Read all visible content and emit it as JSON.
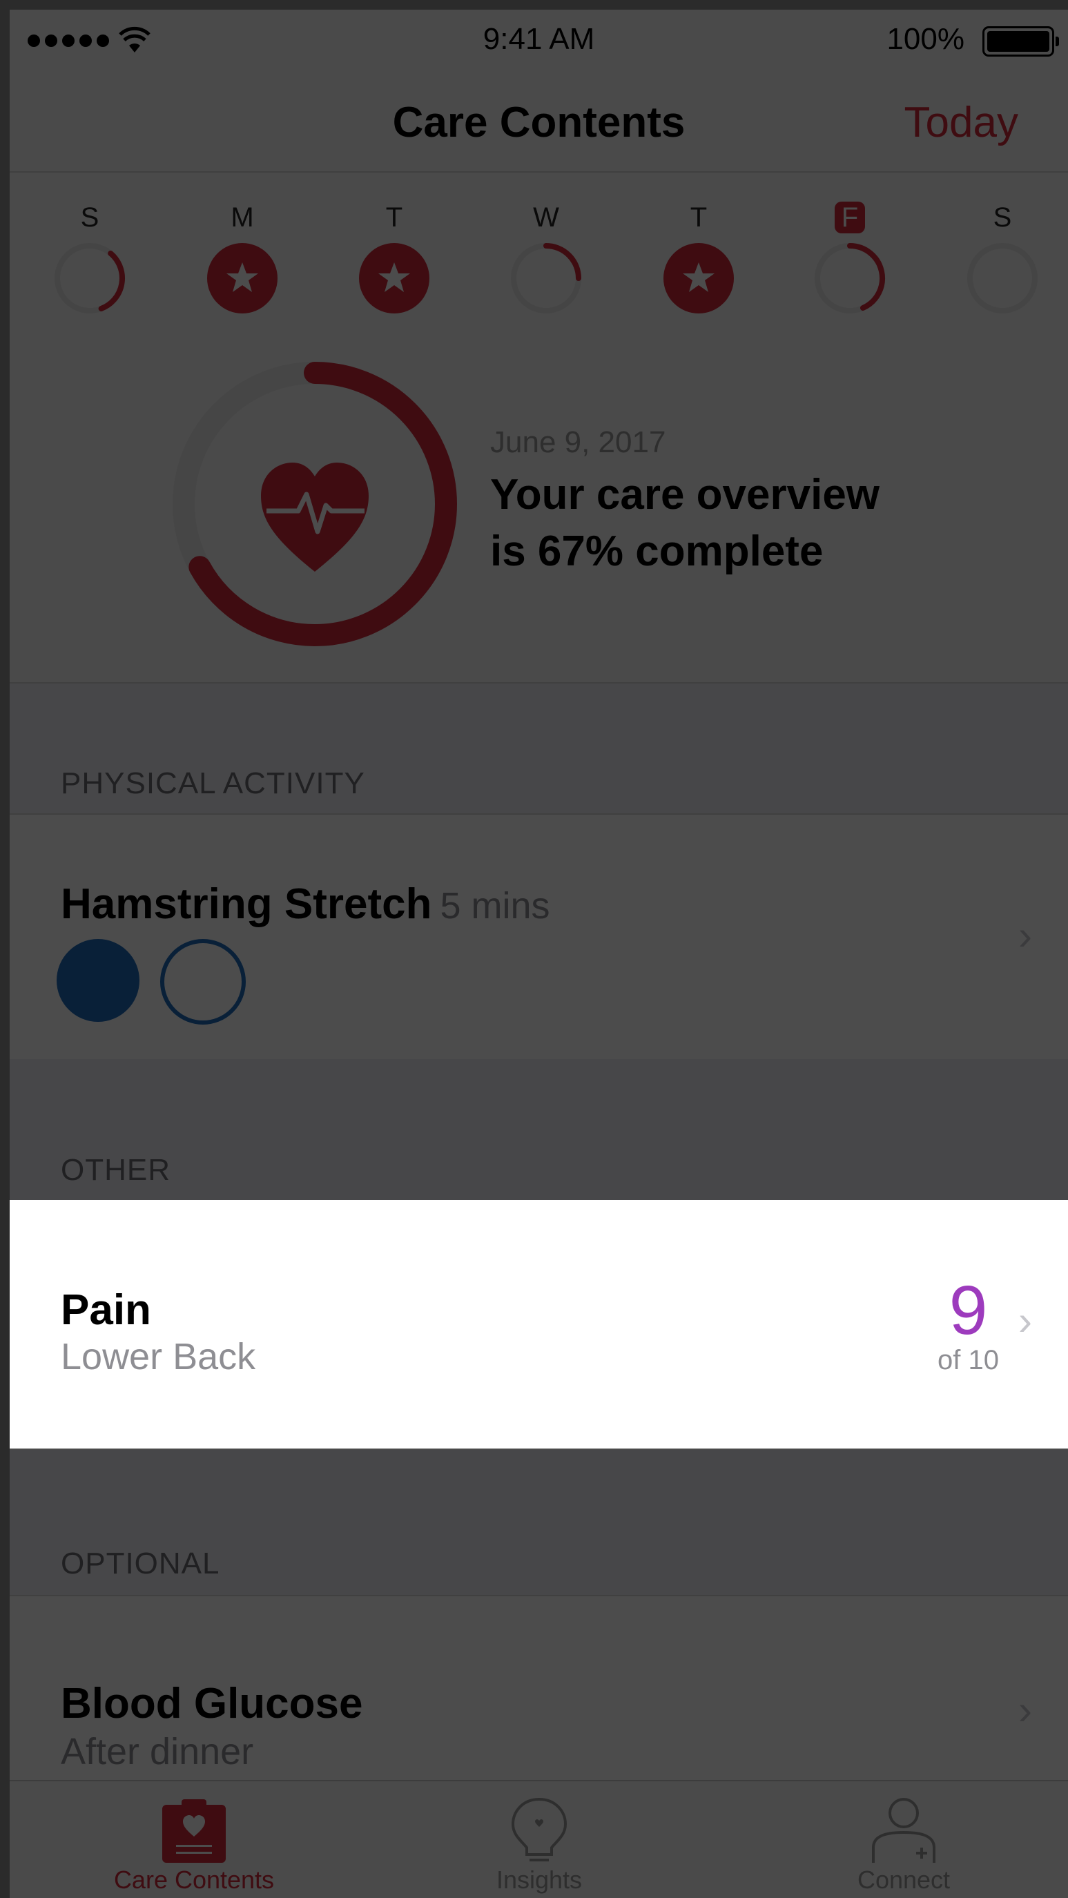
{
  "status_bar": {
    "time": "9:41 AM",
    "battery": "100%"
  },
  "nav": {
    "title": "Care Contents",
    "today_button": "Today"
  },
  "week": {
    "days": [
      {
        "letter": "S",
        "state": "partial",
        "progress": 0.33,
        "selected": false
      },
      {
        "letter": "M",
        "state": "complete",
        "progress": 1.0,
        "selected": false
      },
      {
        "letter": "T",
        "state": "complete",
        "progress": 1.0,
        "selected": false
      },
      {
        "letter": "W",
        "state": "partial",
        "progress": 0.25,
        "selected": false
      },
      {
        "letter": "T",
        "state": "complete",
        "progress": 1.0,
        "selected": false
      },
      {
        "letter": "F",
        "state": "partial",
        "progress": 0.4,
        "selected": true
      },
      {
        "letter": "S",
        "state": "empty",
        "progress": 0,
        "selected": false
      }
    ]
  },
  "overview": {
    "date": "June 9, 2017",
    "line1": "Your care overview",
    "line2": "is 67% complete",
    "progress": 0.67
  },
  "sections": {
    "physical_activity": {
      "header": "PHYSICAL ACTIVITY",
      "item": {
        "title": "Hamstring Stretch",
        "duration": "5 mins",
        "completed": [
          true,
          false
        ]
      }
    },
    "other": {
      "header": "OTHER",
      "item": {
        "title": "Pain",
        "subtitle": "Lower Back",
        "value": "9",
        "value_of": "of 10"
      }
    },
    "optional": {
      "header": "OPTIONAL",
      "item": {
        "title": "Blood Glucose",
        "subtitle": "After dinner"
      }
    }
  },
  "tabbar": {
    "tabs": [
      {
        "label": "Care Contents",
        "icon": "clipboard-heart-icon",
        "active": true
      },
      {
        "label": "Insights",
        "icon": "lightbulb-icon",
        "active": false
      },
      {
        "label": "Connect",
        "icon": "person-add-icon",
        "active": false
      }
    ]
  },
  "colors": {
    "accent": "#d3283a",
    "activity": "#1f6bbd",
    "pain_value": "#9d3bbd"
  }
}
